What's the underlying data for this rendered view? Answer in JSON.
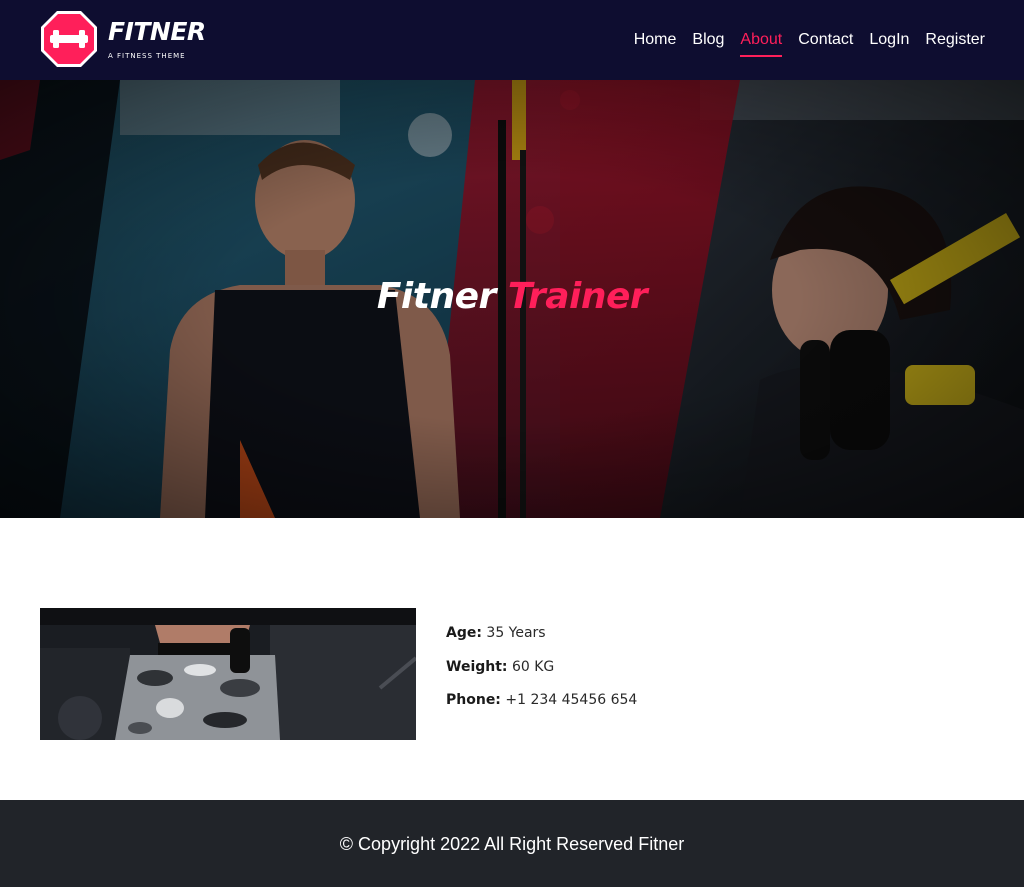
{
  "brand": {
    "name": "FITNER",
    "tagline": "A FITNESS THEME",
    "badge_color": "#ff1f5a"
  },
  "nav": {
    "items": [
      {
        "label": "Home"
      },
      {
        "label": "Blog"
      },
      {
        "label": "About"
      },
      {
        "label": "Contact"
      },
      {
        "label": "LogIn"
      },
      {
        "label": "Register"
      }
    ],
    "active": "About"
  },
  "hero": {
    "title_part1": "Fitner",
    "title_part2": "Trainer"
  },
  "trainer": {
    "age_label": "Age:",
    "age_value": "35 Years",
    "weight_label": "Weight:",
    "weight_value": "60 KG",
    "phone_label": "Phone:",
    "phone_value": "+1 234 45456 654"
  },
  "footer": {
    "copyright": "© Copyright 2022 All Right Reserved Fitner"
  },
  "colors": {
    "header_bg": "#0e0d30",
    "accent": "#ff1f5a",
    "footer_bg": "#212429"
  }
}
